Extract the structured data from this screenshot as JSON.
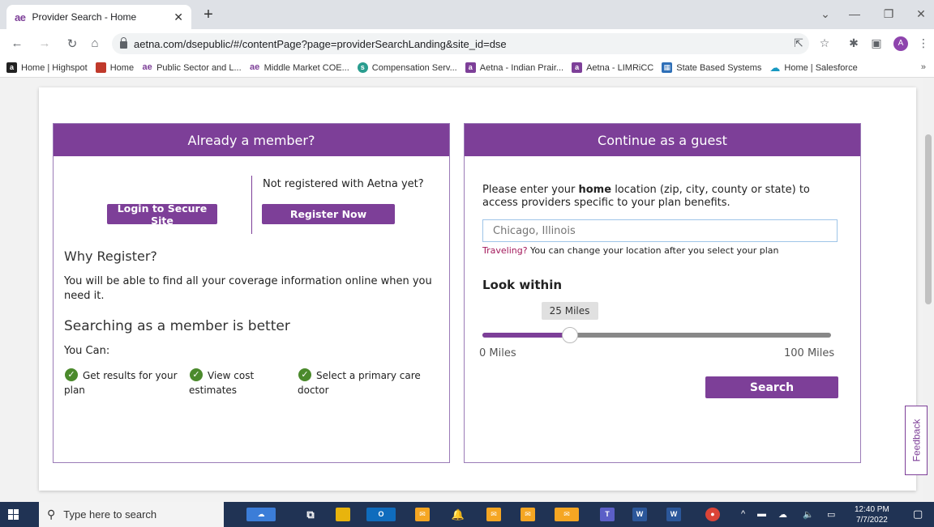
{
  "browser": {
    "tab_title": "Provider Search - Home",
    "tab_favicon": "ae",
    "url": "aetna.com/dsepublic/#/contentPage?page=providerSearchLanding&site_id=dse",
    "profile_initial": "A",
    "bookmarks": [
      {
        "label": "Home | Highspot",
        "icon": "a",
        "color": "#222222"
      },
      {
        "label": "Home",
        "icon": "",
        "color": "#c0392b"
      },
      {
        "label": "Public Sector and L...",
        "icon": "ae",
        "color": "#7d3f98"
      },
      {
        "label": "Middle Market COE...",
        "icon": "ae",
        "color": "#7d3f98"
      },
      {
        "label": "Compensation Serv...",
        "icon": "s",
        "color": "#2a9d8f"
      },
      {
        "label": "Aetna - Indian Prair...",
        "icon": "a",
        "color": "#7d3f98"
      },
      {
        "label": "Aetna - LIMRiCC",
        "icon": "a",
        "color": "#7d3f98"
      },
      {
        "label": "State Based Systems",
        "icon": "▦",
        "color": "#2e6fb7"
      },
      {
        "label": "Home | Salesforce",
        "icon": "☁",
        "color": "#1798c1"
      }
    ],
    "more_bookmarks": "»"
  },
  "member": {
    "header": "Already a member?",
    "not_registered": "Not registered with Aetna yet?",
    "login_label": "Login to Secure Site",
    "register_label": "Register Now",
    "why_heading": "Why Register?",
    "why_text": "You will be able to find all your coverage information online when you need it.",
    "better_heading": "Searching as a member is better",
    "you_can": "You Can:",
    "benefits": [
      "Get results for your plan",
      "View cost estimates",
      "Select a primary care doctor"
    ]
  },
  "guest": {
    "header": "Continue as a guest",
    "prompt_before": "Please enter your ",
    "prompt_bold": "home",
    "prompt_after": " location (zip, city, county or state) to access providers specific to your plan benefits.",
    "location_placeholder": "Chicago, Illinois",
    "traveling_link": "Traveling?",
    "traveling_text": " You can change your location after you select your plan",
    "look_within": "Look within",
    "slider_value_label": "25 Miles",
    "slider_fraction": 0.25,
    "min_label": "0 Miles",
    "max_label": "100 Miles",
    "search_label": "Search"
  },
  "feedback_label": "Feedback",
  "taskbar": {
    "search_placeholder": "Type here to search",
    "time": "12:40 PM",
    "date": "7/7/2022"
  },
  "colors": {
    "brand_purple": "#7d3f98",
    "check_green": "#4b8a2c",
    "link_red": "#a3195b"
  }
}
